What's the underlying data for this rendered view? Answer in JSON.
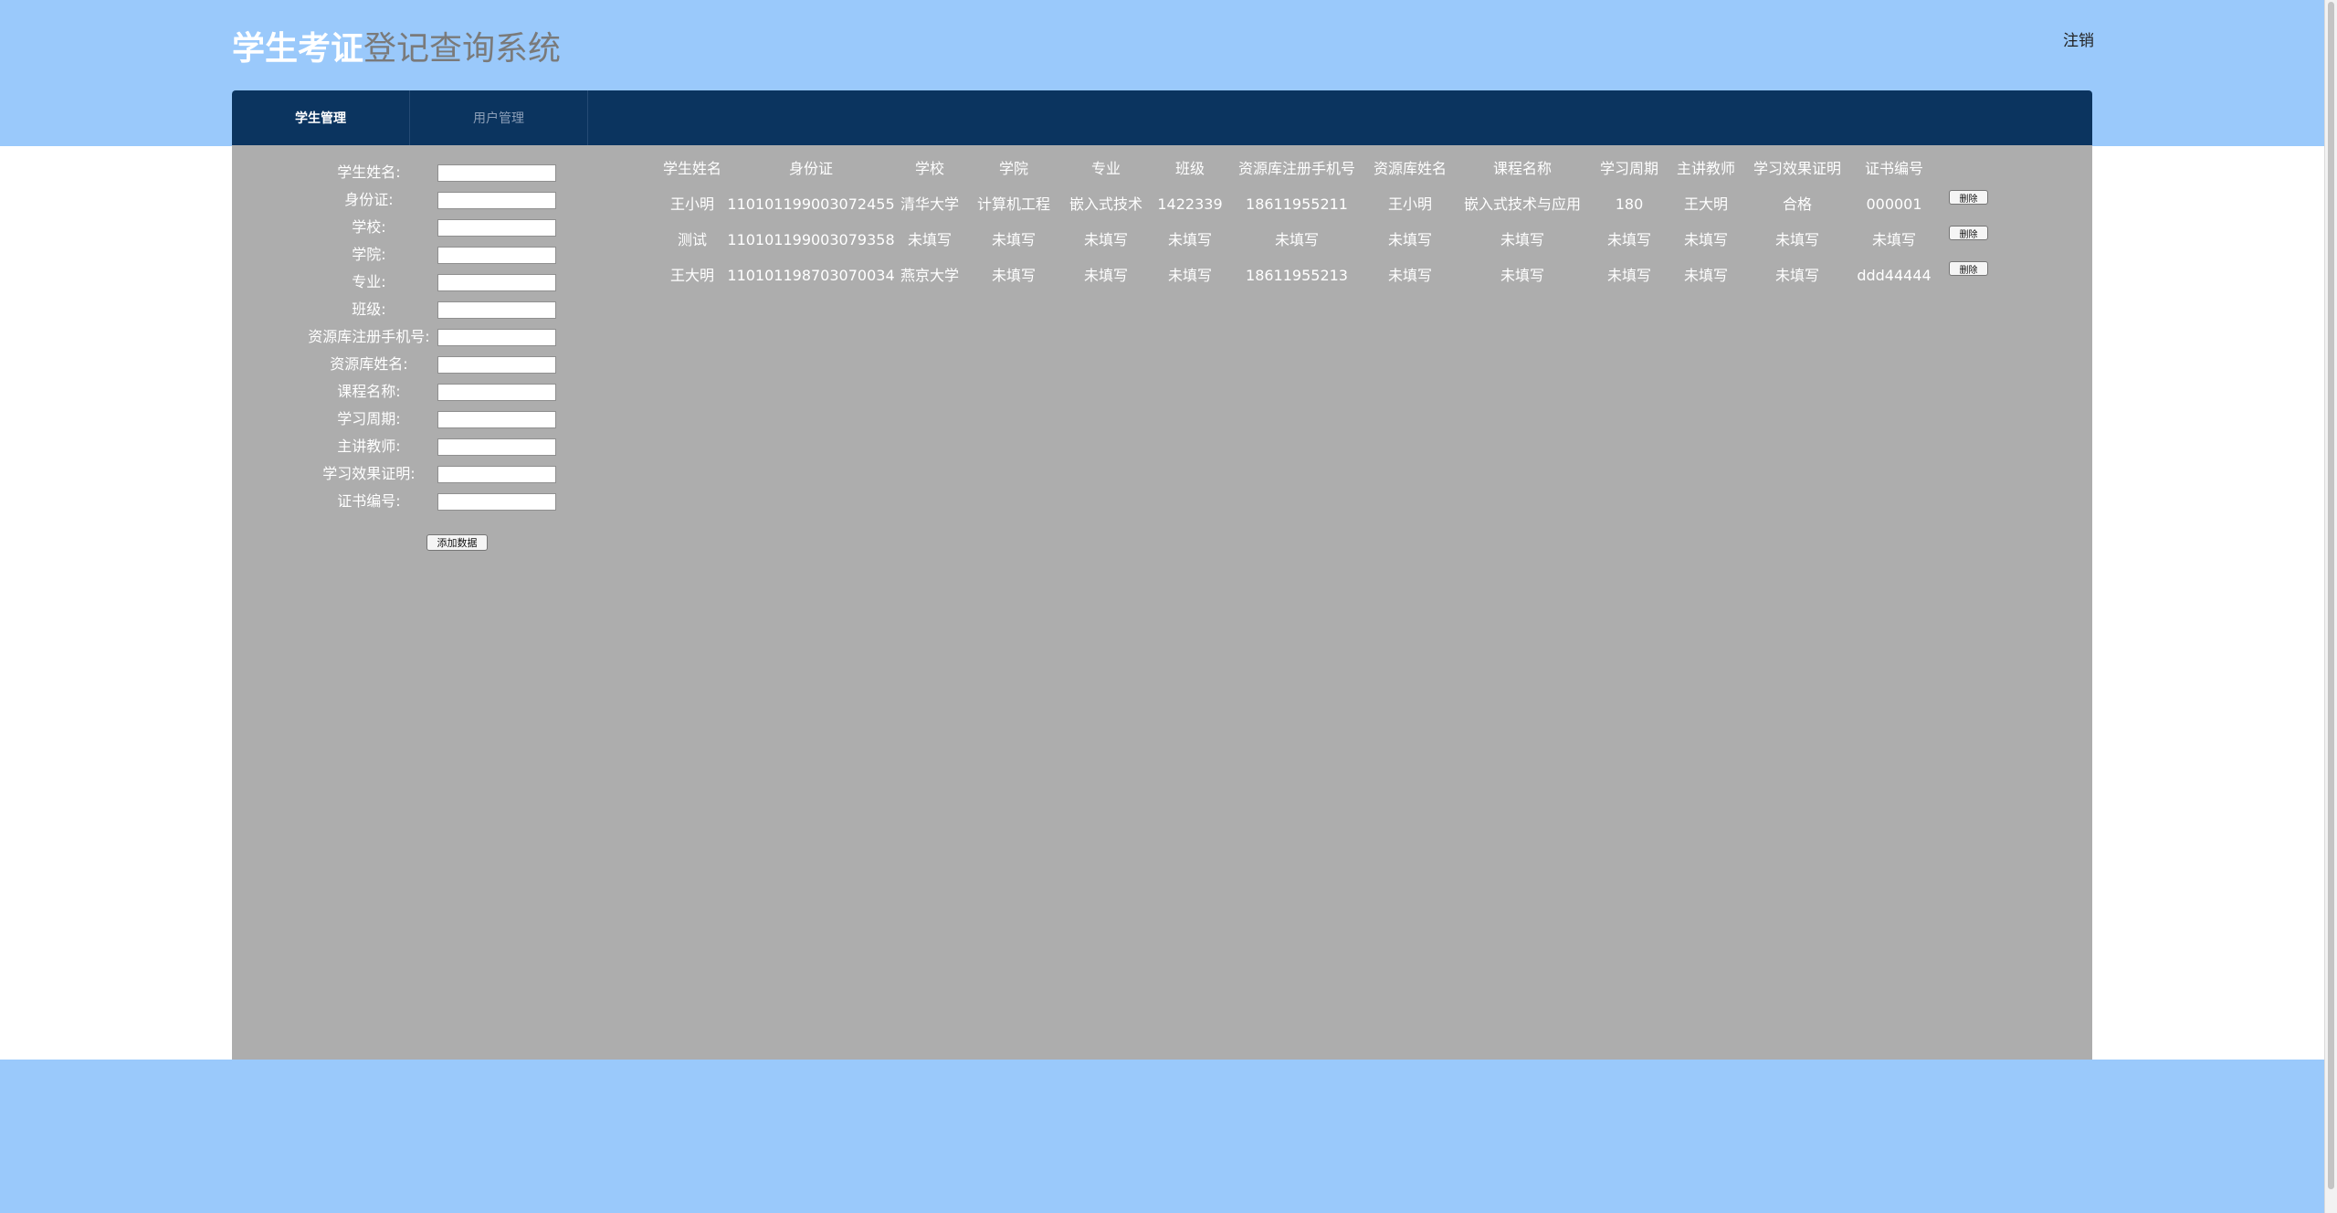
{
  "header": {
    "title_part1": "学生考证",
    "title_part2": "登记查询系统",
    "logout_label": "注销"
  },
  "nav": {
    "tabs": [
      {
        "label": "学生管理",
        "active": true
      },
      {
        "label": "用户管理",
        "active": false
      }
    ]
  },
  "form": {
    "fields": [
      {
        "label": "学生姓名:",
        "value": ""
      },
      {
        "label": "身份证:",
        "value": ""
      },
      {
        "label": "学校:",
        "value": ""
      },
      {
        "label": "学院:",
        "value": ""
      },
      {
        "label": "专业:",
        "value": ""
      },
      {
        "label": "班级:",
        "value": ""
      },
      {
        "label": "资源库注册手机号:",
        "value": ""
      },
      {
        "label": "资源库姓名:",
        "value": ""
      },
      {
        "label": "课程名称:",
        "value": ""
      },
      {
        "label": "学习周期:",
        "value": ""
      },
      {
        "label": "主讲教师:",
        "value": ""
      },
      {
        "label": "学习效果证明:",
        "value": ""
      },
      {
        "label": "证书编号:",
        "value": ""
      }
    ],
    "add_button_label": "添加数据"
  },
  "table": {
    "headers": [
      "学生姓名",
      "身份证",
      "学校",
      "学院",
      "专业",
      "班级",
      "资源库注册手机号",
      "资源库姓名",
      "课程名称",
      "学习周期",
      "主讲教师",
      "学习效果证明",
      "证书编号"
    ],
    "rows": [
      [
        "王小明",
        "110101199003072455",
        "清华大学",
        "计算机工程",
        "嵌入式技术",
        "1422339",
        "18611955211",
        "王小明",
        "嵌入式技术与应用",
        "180",
        "王大明",
        "合格",
        "000001"
      ],
      [
        "测试",
        "110101199003079358",
        "未填写",
        "未填写",
        "未填写",
        "未填写",
        "未填写",
        "未填写",
        "未填写",
        "未填写",
        "未填写",
        "未填写",
        "未填写"
      ],
      [
        "王大明",
        "110101198703070034",
        "燕京大学",
        "未填写",
        "未填写",
        "未填写",
        "18611955213",
        "未填写",
        "未填写",
        "未填写",
        "未填写",
        "未填写",
        "ddd44444"
      ]
    ],
    "delete_label": "删除"
  },
  "colors": {
    "page_background": "#9ac9fb",
    "nav_background": "#0b345f",
    "content_background": "#adadad"
  }
}
